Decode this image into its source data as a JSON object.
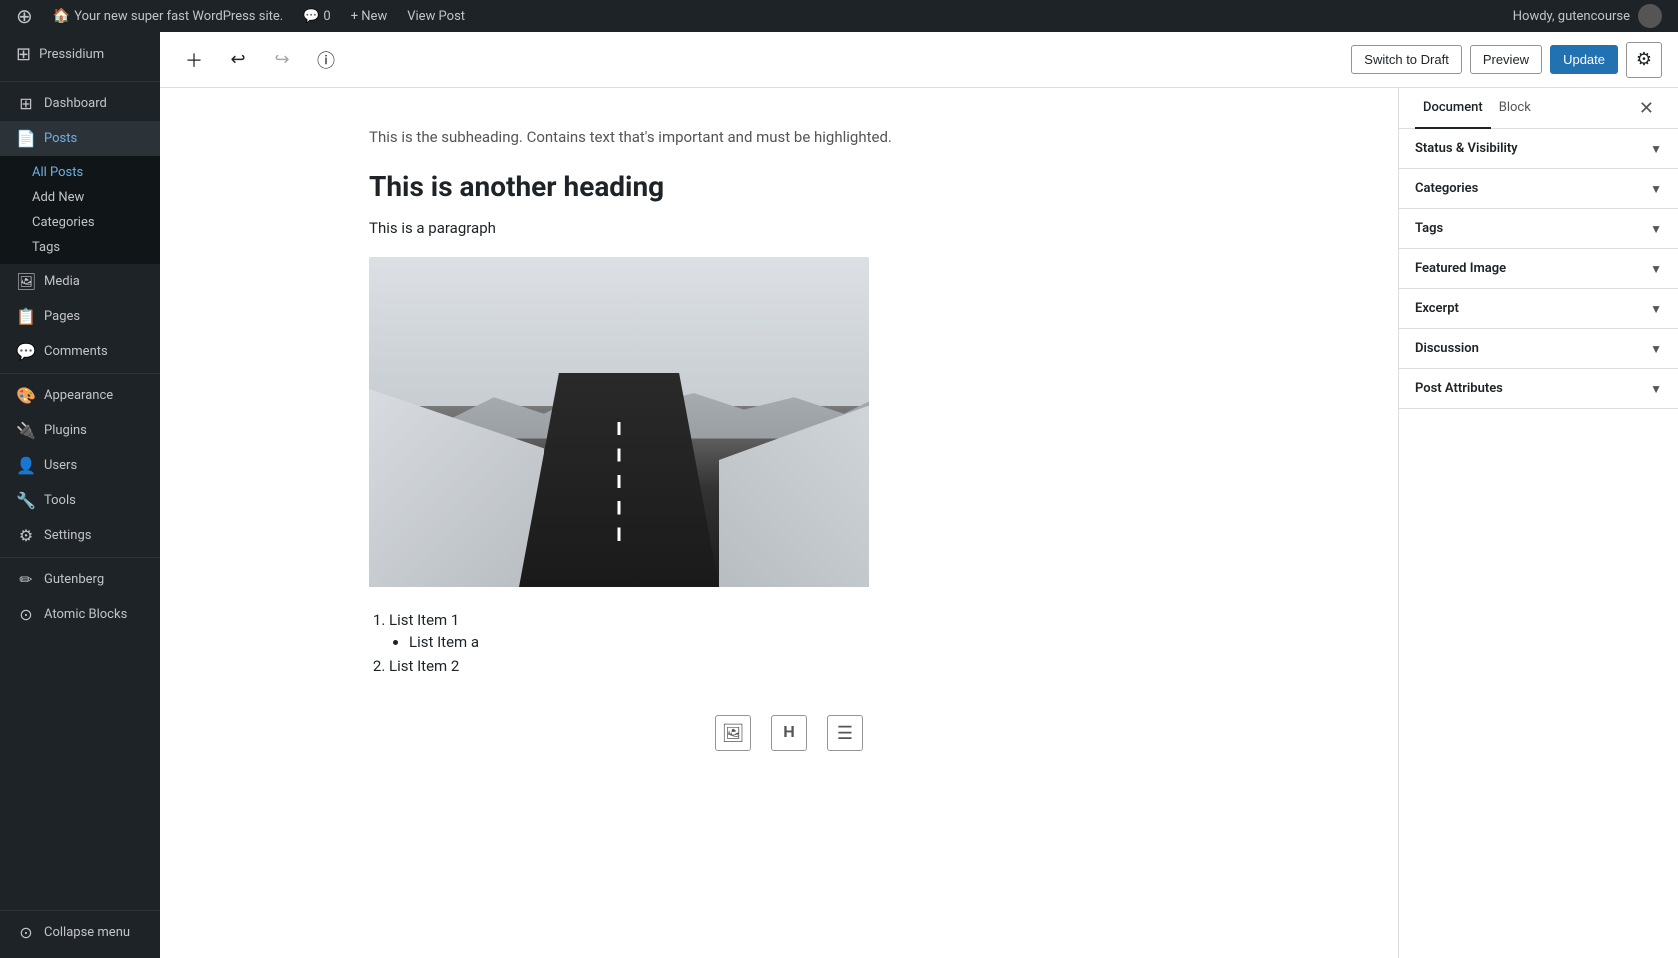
{
  "adminbar": {
    "wp_logo": "⊕",
    "site_name": "Your new super fast WordPress site.",
    "comments_icon": "💬",
    "comments_count": "0",
    "new_label": "+ New",
    "view_post_label": "View Post",
    "howdy": "Howdy, gutencourse"
  },
  "sidebar": {
    "brand_name": "Pressidium",
    "menu_items": [
      {
        "id": "dashboard",
        "label": "Dashboard",
        "icon": "⊞"
      },
      {
        "id": "posts",
        "label": "Posts",
        "icon": "📄",
        "active_parent": true
      },
      {
        "id": "media",
        "label": "Media",
        "icon": "🖼"
      },
      {
        "id": "pages",
        "label": "Pages",
        "icon": "📋"
      },
      {
        "id": "comments",
        "label": "Comments",
        "icon": "💬"
      },
      {
        "id": "appearance",
        "label": "Appearance",
        "icon": "🎨"
      },
      {
        "id": "plugins",
        "label": "Plugins",
        "icon": "🔌"
      },
      {
        "id": "users",
        "label": "Users",
        "icon": "👤"
      },
      {
        "id": "tools",
        "label": "Tools",
        "icon": "🔧"
      },
      {
        "id": "settings",
        "label": "Settings",
        "icon": "⚙"
      },
      {
        "id": "gutenberg",
        "label": "Gutenberg",
        "icon": "✏"
      },
      {
        "id": "atomic-blocks",
        "label": "Atomic Blocks",
        "icon": "⊙"
      }
    ],
    "posts_submenu": [
      {
        "id": "all-posts",
        "label": "All Posts",
        "active": true
      },
      {
        "id": "add-new",
        "label": "Add New"
      },
      {
        "id": "categories",
        "label": "Categories"
      },
      {
        "id": "tags",
        "label": "Tags"
      }
    ],
    "collapse_label": "Collapse menu"
  },
  "toolbar": {
    "add_block_icon": "+",
    "undo_icon": "↩",
    "redo_icon": "↪",
    "info_icon": "ⓘ",
    "switch_draft_label": "Switch to Draft",
    "preview_label": "Preview",
    "update_label": "Update",
    "settings_icon": "⚙"
  },
  "content": {
    "subheading": "This is the subheading. Contains text that's important and must be highlighted.",
    "heading": "This is another heading",
    "paragraph": "This is a paragraph",
    "list_items": [
      {
        "text": "List Item 1",
        "sub_items": [
          "List Item a"
        ]
      },
      {
        "text": "List Item 2"
      }
    ]
  },
  "right_panel": {
    "tab_document": "Document",
    "tab_block": "Block",
    "close_icon": "✕",
    "sections": [
      {
        "id": "status-visibility",
        "title": "Status & Visibility"
      },
      {
        "id": "categories",
        "title": "Categories"
      },
      {
        "id": "tags",
        "title": "Tags"
      },
      {
        "id": "featured-image",
        "title": "Featured Image"
      },
      {
        "id": "excerpt",
        "title": "Excerpt"
      },
      {
        "id": "discussion",
        "title": "Discussion"
      },
      {
        "id": "post-attributes",
        "title": "Post Attributes"
      }
    ]
  }
}
